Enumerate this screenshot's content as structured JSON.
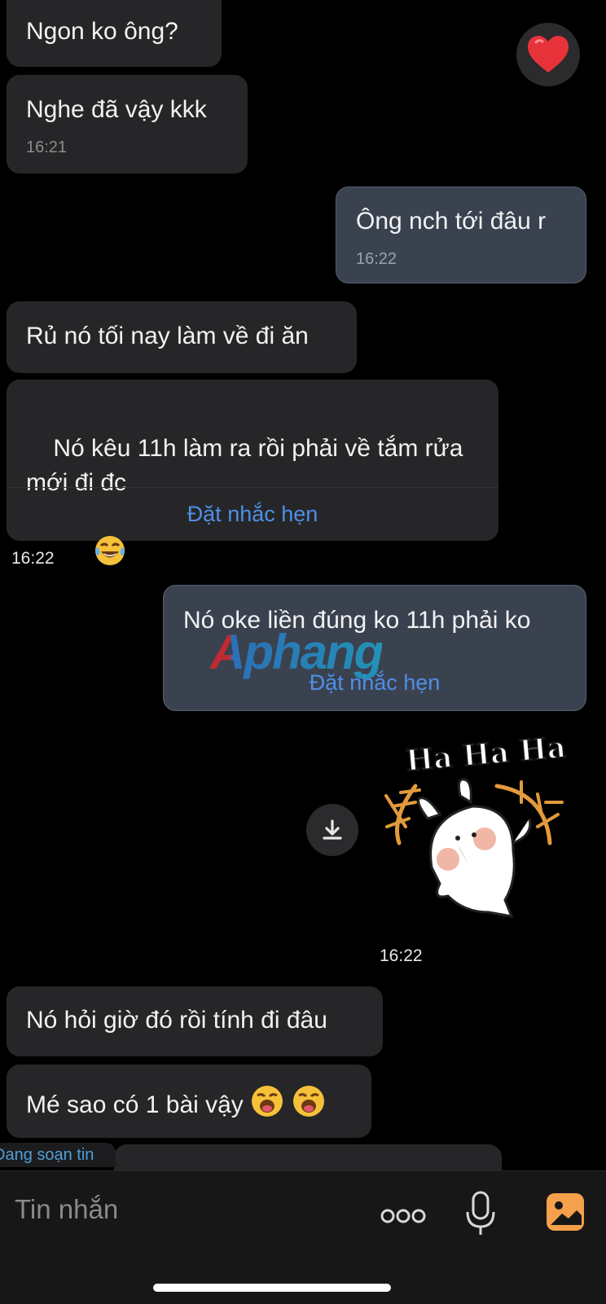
{
  "messages": {
    "m1": {
      "text": "Ngon ko ông?"
    },
    "m2": {
      "text": "Nghe đã vậy kkk",
      "time": "16:21"
    },
    "m3": {
      "text": "Ông nch tới đâu r",
      "time": "16:22"
    },
    "m4": {
      "text": "Rủ nó tối nay làm về đi ăn"
    },
    "m5": {
      "text": "Nó kêu 11h làm ra rồi phải về tắm rửa mới đi đc",
      "remind": "Đặt nhắc hẹn"
    },
    "m5_time": "16:22",
    "m6": {
      "text": "Nó oke liền đúng ko 11h phải ko",
      "remind": "Đặt nhắc hẹn"
    },
    "sticker": {
      "text": "Ha Ha Ha",
      "time": "16:22"
    },
    "m7": {
      "text": "Nó hỏi giờ đó rồi tính đi đâu"
    },
    "m8": {
      "text": "Mé sao có 1 bài vậy"
    }
  },
  "typing_indicator": "Đang soạn tin",
  "watermark": "Aphang",
  "composer": {
    "placeholder": "Tin nhắn",
    "icons": [
      "more-icon",
      "microphone-icon",
      "image-icon"
    ]
  },
  "reaction": "heart-icon",
  "colors": {
    "background": "#000000",
    "incoming_bubble": "#262628",
    "outgoing_bubble": "#3a4250",
    "link": "#4f8fe6",
    "image_icon": "#f5a04a"
  }
}
